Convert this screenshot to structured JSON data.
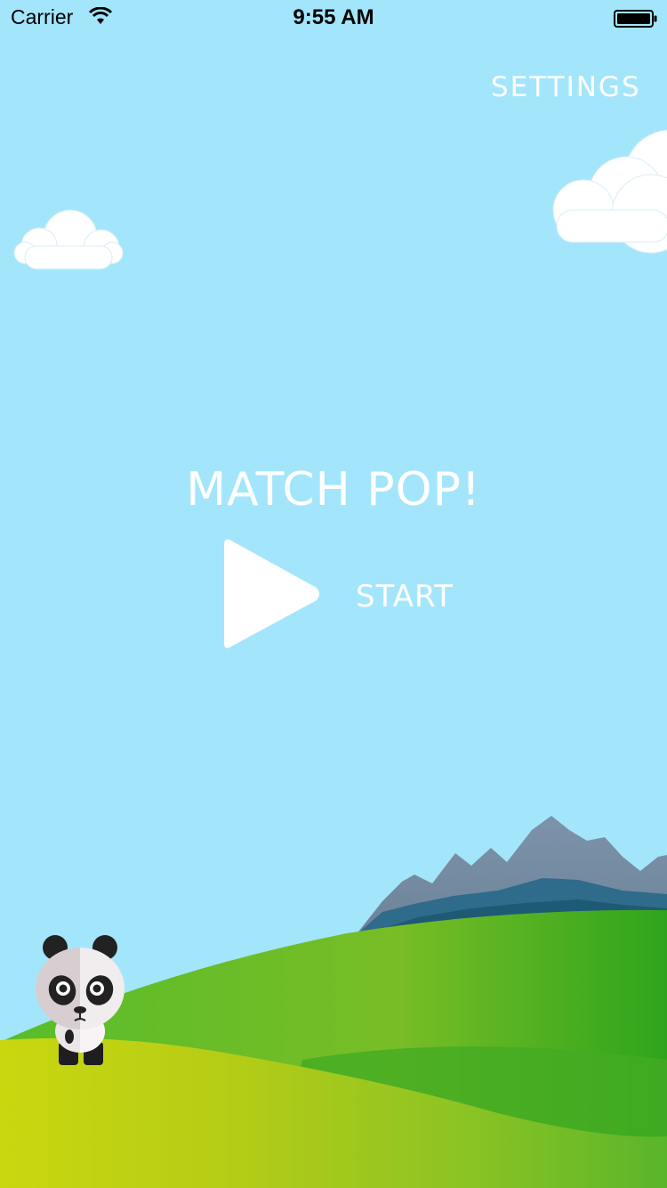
{
  "status_bar": {
    "carrier": "Carrier",
    "time": "9:55 AM"
  },
  "header": {
    "settings_label": "SETTINGS"
  },
  "main": {
    "title": "MATCH POP!",
    "start_label": "START"
  },
  "icons": {
    "wifi": "wifi-icon",
    "battery": "battery-icon",
    "play": "play-icon",
    "panda": "panda-mascot"
  },
  "colors": {
    "sky": "#a3e6fc",
    "text": "#ffffff",
    "grass_front": "#c8d612",
    "grass_back": "#4fb52a",
    "mountain": "#6f8aa3"
  }
}
